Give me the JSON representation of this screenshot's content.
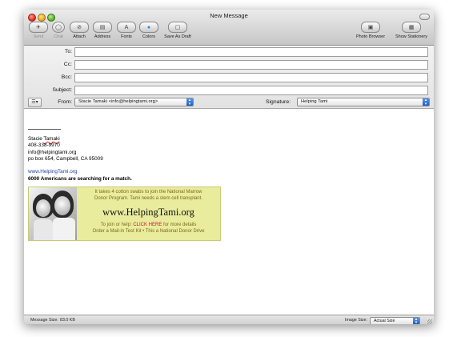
{
  "window": {
    "title": "New Message"
  },
  "toolbar": {
    "items": [
      {
        "label": "Send",
        "icon": "send-icon",
        "glyph": "✈",
        "enabled": false
      },
      {
        "label": "Chat",
        "icon": "chat-icon",
        "glyph": "◯",
        "enabled": false
      },
      {
        "label": "Attach",
        "icon": "paperclip-icon",
        "glyph": "⊘",
        "enabled": true
      },
      {
        "label": "Address",
        "icon": "address-book-icon",
        "glyph": "▤",
        "enabled": true
      },
      {
        "label": "Fonts",
        "icon": "fonts-icon",
        "glyph": "A",
        "enabled": true
      },
      {
        "label": "Colors",
        "icon": "color-wheel-icon",
        "glyph": "●",
        "enabled": true
      },
      {
        "label": "Save As Draft",
        "icon": "draft-icon",
        "glyph": "▢",
        "enabled": true
      },
      {
        "label": "Photo Browser",
        "icon": "photo-browser-icon",
        "glyph": "▣",
        "enabled": true
      },
      {
        "label": "Show Stationery",
        "icon": "stationery-icon",
        "glyph": "▦",
        "enabled": true
      }
    ]
  },
  "headers": {
    "to_label": "To:",
    "to_value": "",
    "cc_label": "Cc:",
    "cc_value": "",
    "bcc_label": "Bcc:",
    "bcc_value": "",
    "subject_label": "Subject:",
    "subject_value": "",
    "from_label": "From:",
    "from_value": "Stacie Tamaki <info@helpingtami.org>",
    "signature_label": "Signature:",
    "signature_value": "Helping Tami",
    "options_glyph": "☰▾"
  },
  "signature": {
    "name_first": "Stacie ",
    "name_last": "Tamaki",
    "phone": "408-338-9970",
    "email": "info@helpingtami.org",
    "address": "po box 654, Campbell, CA 95009",
    "website": "www.HelpingTami.org",
    "tagline": "6000 Americans are searching for a match."
  },
  "banner": {
    "line1": "It takes 4 cotton swabs to join the National Marrow",
    "line2": "Donor Program. Tami needs a stem cell transplant.",
    "url": "www.HelpingTami.org",
    "join_prefix": "To join or help: ",
    "join_link": "CLICK HERE",
    "join_suffix": " for more details",
    "footer": "Order a Mail-in Test Kit • This a National Donor Drive"
  },
  "status": {
    "message_size_label": "Message Size:",
    "message_size_value": "83.0 KB",
    "image_size_label": "Image Size:",
    "image_size_value": "Actual Size"
  }
}
